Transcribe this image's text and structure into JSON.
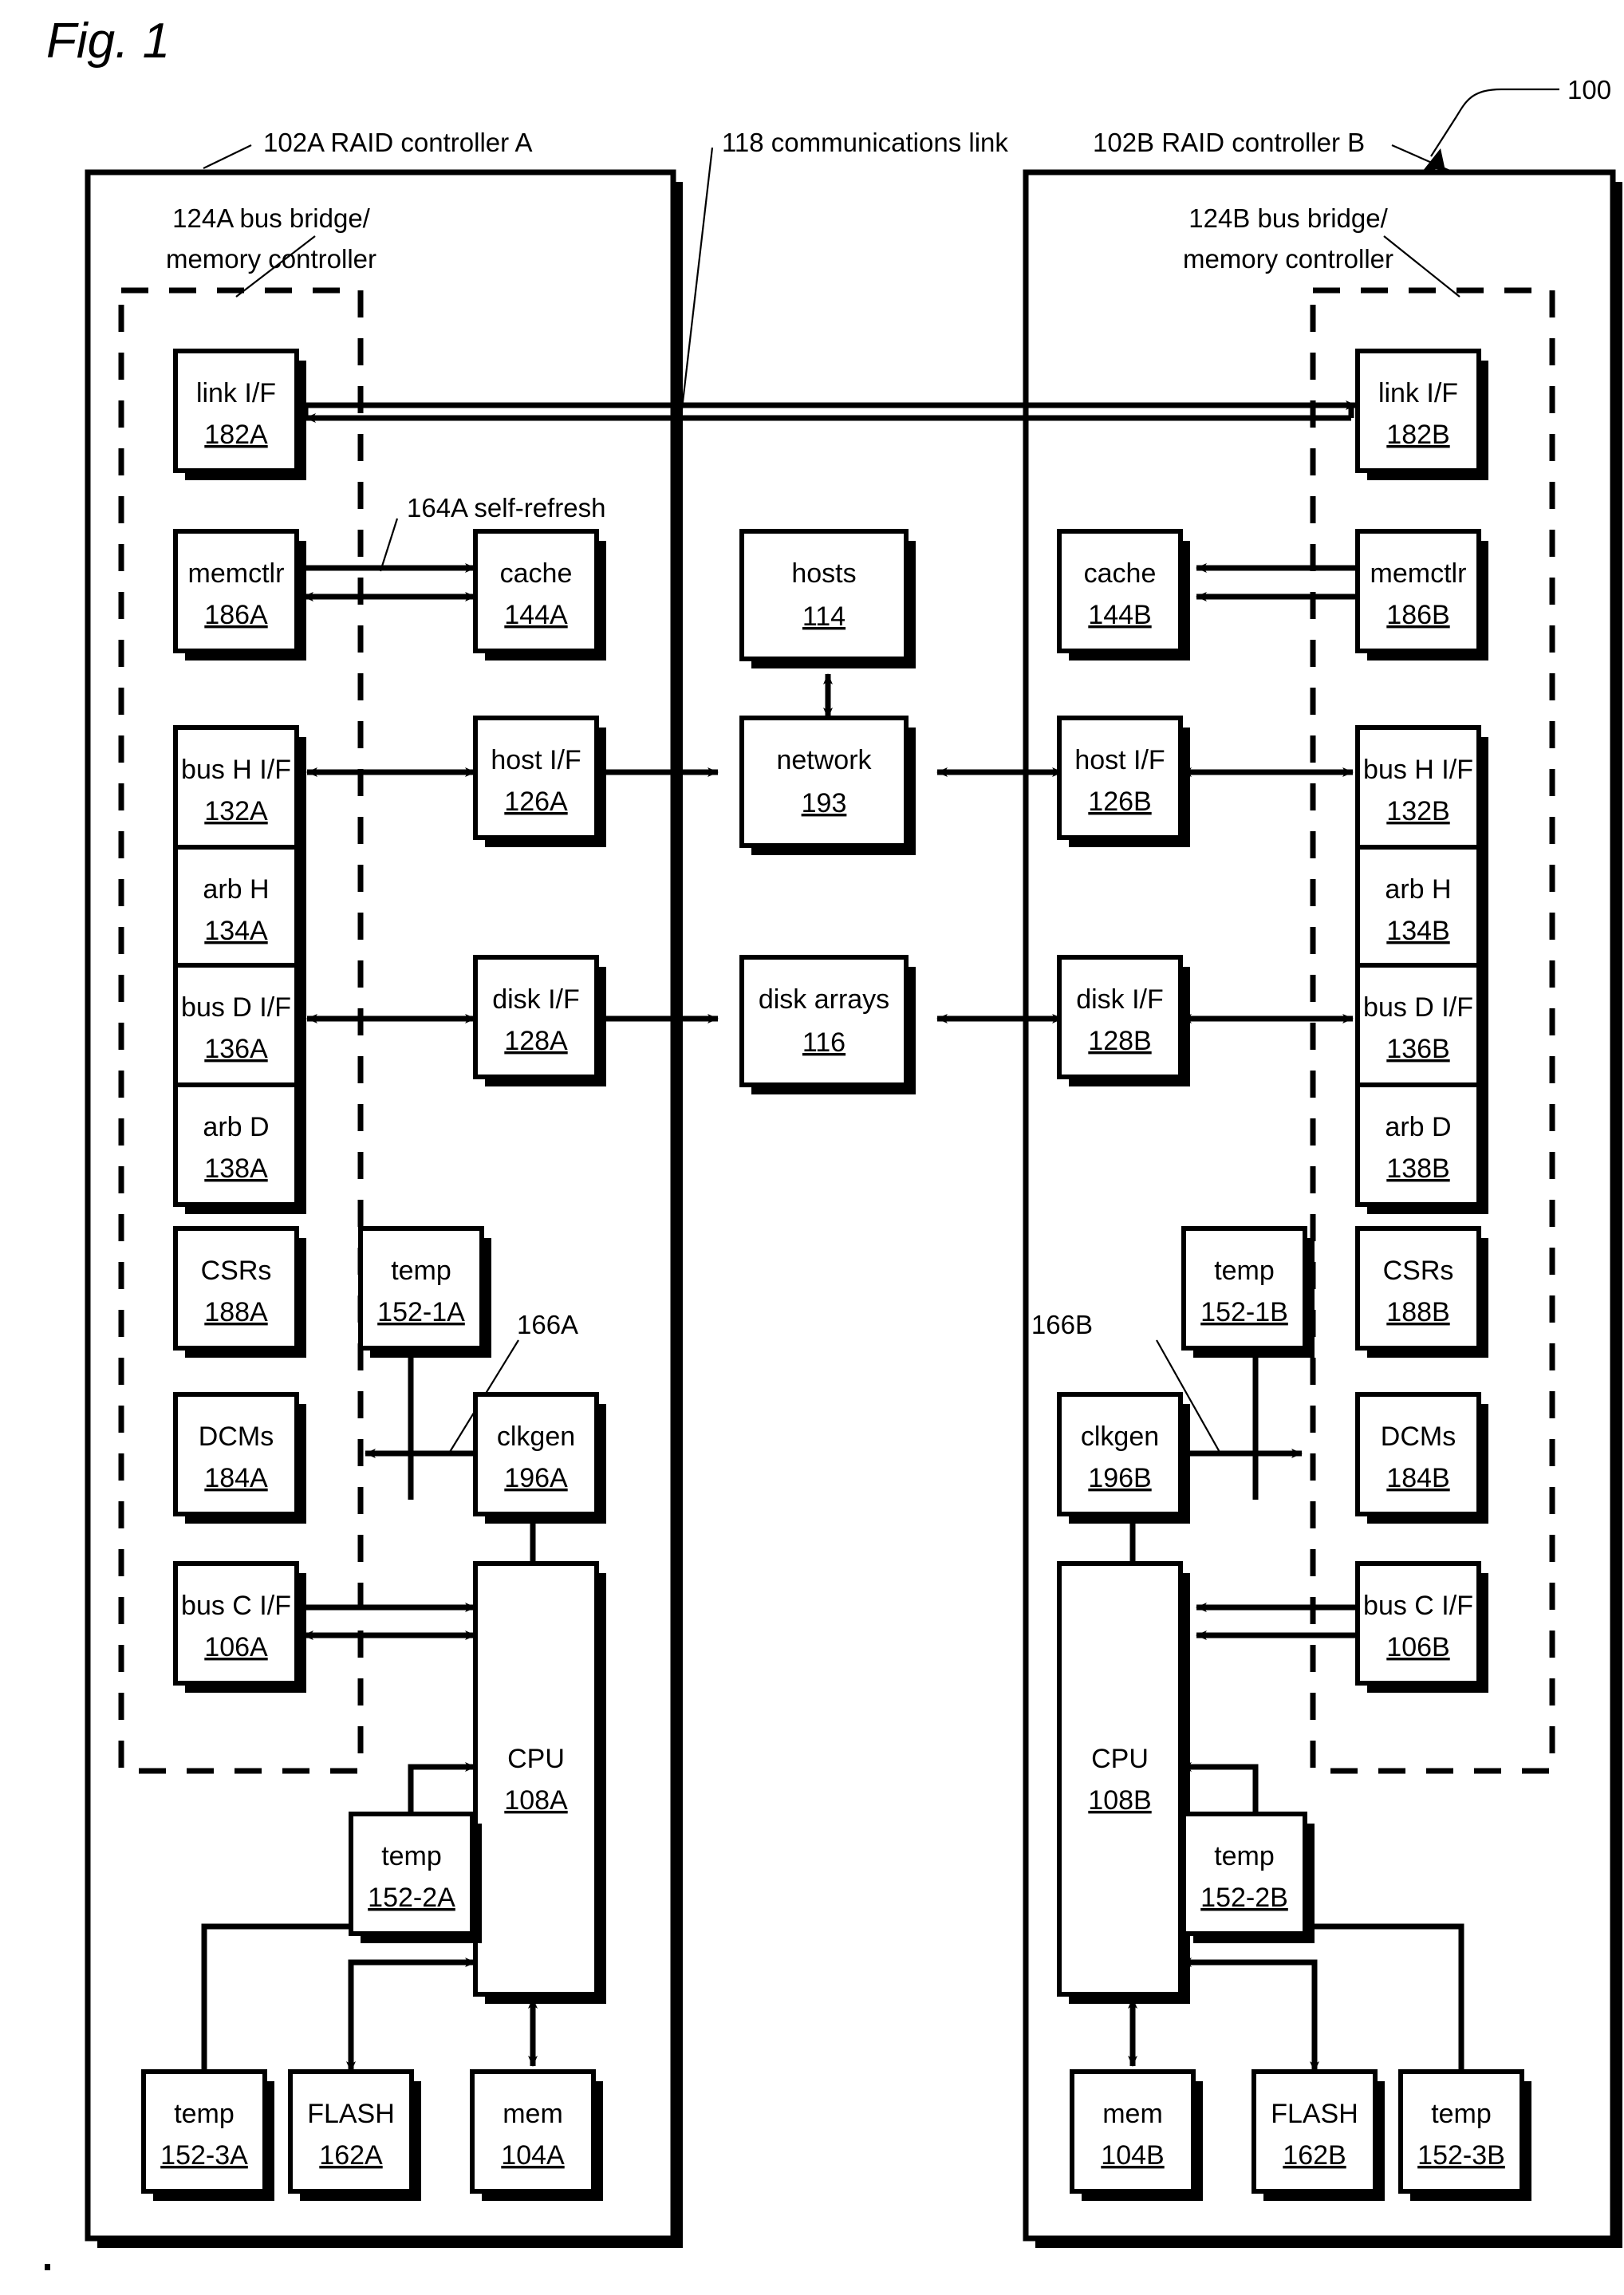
{
  "figure": {
    "title": "Fig. 1",
    "system_ref": "100"
  },
  "annotations": {
    "controller_a": "102A  RAID controller A",
    "controller_b": "102B  RAID controller B",
    "comm_link": "118  communications link",
    "bridge_a_line1": "124A bus bridge/",
    "bridge_a_line2": "memory controller",
    "bridge_b_line1": "124B bus bridge/",
    "bridge_b_line2": "memory controller",
    "self_refresh_a": "164A  self-refresh",
    "clk_ref_a": "166A",
    "clk_ref_b": "166B"
  },
  "blocks": {
    "link_if_a": {
      "label": "link I/F",
      "ref": "182A"
    },
    "link_if_b": {
      "label": "link I/F",
      "ref": "182B"
    },
    "memctlr_a": {
      "label": "memctlr",
      "ref": "186A"
    },
    "memctlr_b": {
      "label": "memctlr",
      "ref": "186B"
    },
    "cache_a": {
      "label": "cache",
      "ref": "144A"
    },
    "cache_b": {
      "label": "cache",
      "ref": "144B"
    },
    "bus_h_if_a": {
      "label": "bus H I/F",
      "ref": "132A"
    },
    "bus_h_if_b": {
      "label": "bus H I/F",
      "ref": "132B"
    },
    "arb_h_a": {
      "label": "arb H",
      "ref": "134A"
    },
    "arb_h_b": {
      "label": "arb H",
      "ref": "134B"
    },
    "host_if_a": {
      "label": "host I/F",
      "ref": "126A"
    },
    "host_if_b": {
      "label": "host I/F",
      "ref": "126B"
    },
    "bus_d_if_a": {
      "label": "bus D I/F",
      "ref": "136A"
    },
    "bus_d_if_b": {
      "label": "bus D I/F",
      "ref": "136B"
    },
    "arb_d_a": {
      "label": "arb D",
      "ref": "138A"
    },
    "arb_d_b": {
      "label": "arb D",
      "ref": "138B"
    },
    "disk_if_a": {
      "label": "disk I/F",
      "ref": "128A"
    },
    "disk_if_b": {
      "label": "disk I/F",
      "ref": "128B"
    },
    "csrs_a": {
      "label": "CSRs",
      "ref": "188A"
    },
    "csrs_b": {
      "label": "CSRs",
      "ref": "188B"
    },
    "temp_1a": {
      "label": "temp",
      "ref": "152-1A"
    },
    "temp_1b": {
      "label": "temp",
      "ref": "152-1B"
    },
    "dcms_a": {
      "label": "DCMs",
      "ref": "184A"
    },
    "dcms_b": {
      "label": "DCMs",
      "ref": "184B"
    },
    "clkgen_a": {
      "label": "clkgen",
      "ref": "196A"
    },
    "clkgen_b": {
      "label": "clkgen",
      "ref": "196B"
    },
    "bus_c_if_a": {
      "label": "bus C I/F",
      "ref": "106A"
    },
    "bus_c_if_b": {
      "label": "bus C I/F",
      "ref": "106B"
    },
    "cpu_a": {
      "label": "CPU",
      "ref": "108A"
    },
    "cpu_b": {
      "label": "CPU",
      "ref": "108B"
    },
    "temp_2a": {
      "label": "temp",
      "ref": "152-2A"
    },
    "temp_2b": {
      "label": "temp",
      "ref": "152-2B"
    },
    "temp_3a": {
      "label": "temp",
      "ref": "152-3A"
    },
    "temp_3b": {
      "label": "temp",
      "ref": "152-3B"
    },
    "flash_a": {
      "label": "FLASH",
      "ref": "162A"
    },
    "flash_b": {
      "label": "FLASH",
      "ref": "162B"
    },
    "mem_a": {
      "label": "mem",
      "ref": "104A"
    },
    "mem_b": {
      "label": "mem",
      "ref": "104B"
    },
    "hosts": {
      "label": "hosts",
      "ref": "114"
    },
    "network": {
      "label": "network",
      "ref": "193"
    },
    "disk_arrays": {
      "label": "disk arrays",
      "ref": "116"
    }
  },
  "colors": {
    "ink": "#000000",
    "paper": "#ffffff"
  }
}
